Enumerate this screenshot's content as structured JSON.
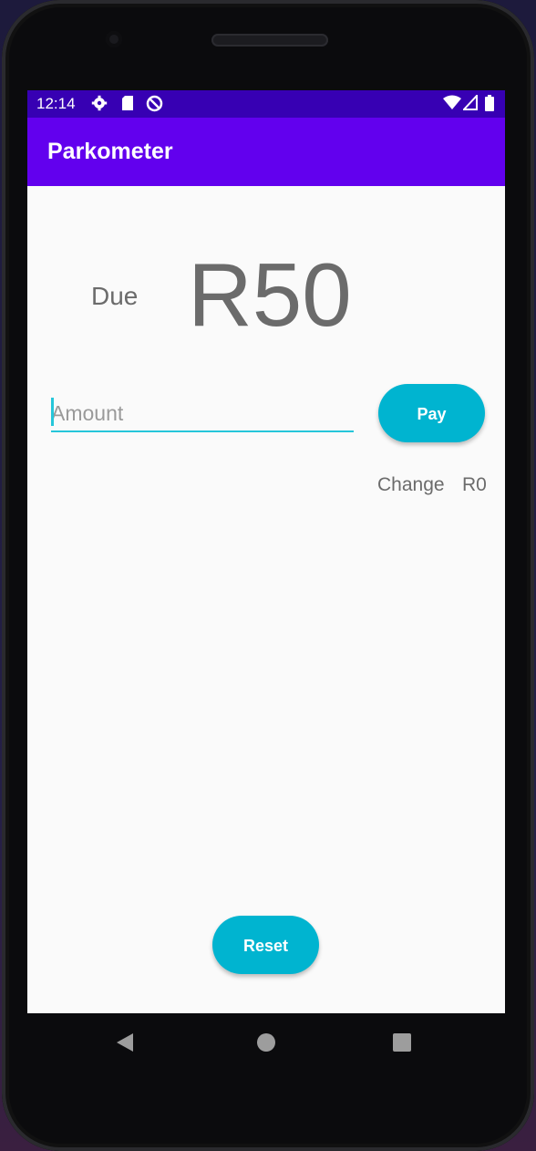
{
  "status_bar": {
    "time": "12:14",
    "left_icons": [
      "gear-icon",
      "sd-card-icon",
      "no-disturb-icon"
    ],
    "right_icons": [
      "wifi-icon",
      "signal-icon",
      "battery-icon"
    ]
  },
  "app_bar": {
    "title": "Parkometer"
  },
  "due": {
    "label": "Due",
    "amount": "R50"
  },
  "amount_input": {
    "placeholder": "Amount",
    "value": ""
  },
  "pay_button": {
    "label": "Pay"
  },
  "change": {
    "label": "Change",
    "value": "R0"
  },
  "reset_button": {
    "label": "Reset"
  },
  "nav_bar": {
    "icons": [
      "back-icon",
      "home-icon",
      "recents-icon"
    ]
  },
  "colors": {
    "status_bar": "#3700b3",
    "app_bar": "#6200ee",
    "accent_button": "#00b4d0",
    "input_underline": "#26c6da"
  }
}
